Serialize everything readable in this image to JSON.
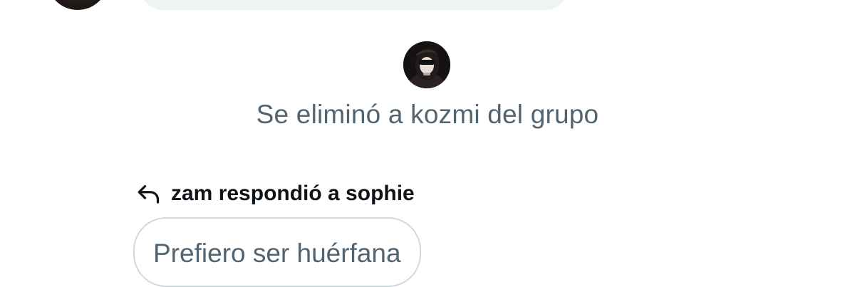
{
  "colors": {
    "secondary_text": "#536471",
    "primary_text": "#0f1419",
    "bubble_bg": "#eff3f4",
    "border": "#cfd9de"
  },
  "system_event": {
    "avatar_icon": "user-avatar",
    "text": "Se eliminó a kozmi del grupo"
  },
  "reply": {
    "icon": "reply-arrow-icon",
    "header": "zam respondió a sophie",
    "quoted_text": "Prefiero ser huérfana"
  }
}
